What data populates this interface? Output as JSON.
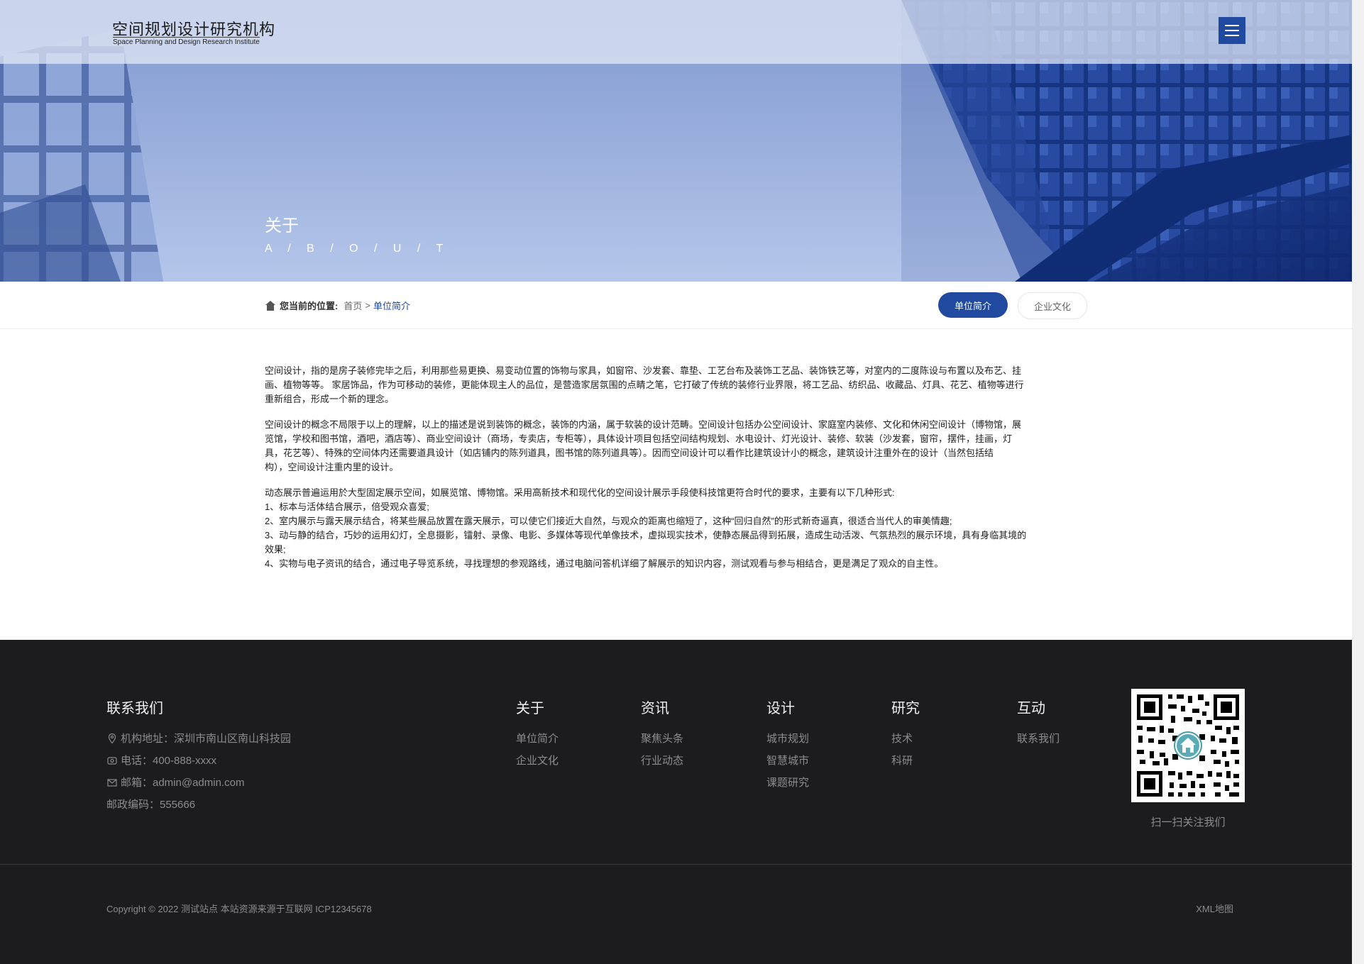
{
  "header": {
    "logo_cn": "空间规划设计研究机构",
    "logo_en": "Space Planning and Design Research Institute",
    "menu_icon": "hamburger-menu-icon"
  },
  "hero": {
    "title": "关于",
    "subtitle": "A / B / O / U / T"
  },
  "breadcrumb": {
    "label": "您当前的位置:",
    "home": "首页",
    "separator": ">",
    "current": "单位简介"
  },
  "tabs": [
    {
      "label": "单位简介",
      "active": true
    },
    {
      "label": "企业文化",
      "active": false
    }
  ],
  "content": {
    "p1": [
      "空间设计，指的是房子装修完毕之后，利用那些易更换、易变动位置的饰物与家具，如窗帘、沙发套、靠垫、工艺台布及装饰工艺品、装饰铁艺等，对室内的二度陈设与布置以及布艺、挂",
      "画、植物等等。 家居饰品，作为可移动的装修，更能体现主人的品位，是营造家居氛围的点睛之笔，它打破了传统的装修行业界限，将工艺品、纺织品、收藏品、灯具、花艺、植物等进行",
      "重新组合，形成一个新的理念。"
    ],
    "p2": [
      "空间设计的概念不局限于以上的理解，以上的描述是说到装饰的概念，装饰的内涵，属于软装的设计范畴。空间设计包括办公空间设计、家庭室内装修、文化和休闲空间设计（博物馆，展",
      "览馆，学校和图书馆，酒吧，酒店等）、商业空间设计（商场，专卖店，专柜等），具体设计项目包括空间结构规划、水电设计、灯光设计、装修、软装（沙发套，窗帘，摆件，挂画，灯",
      "具，花艺等）、特殊的空间体内还需要道具设计（如店铺内的陈列道具，图书馆的陈列道具等）。因而空间设计可以看作比建筑设计小的概念，建筑设计注重外在的设计（当然包括结",
      "构），空间设计注重内里的设计。"
    ],
    "p3": [
      "动态展示普遍运用於大型固定展示空间，如展览馆、博物馆。采用高新技术和现代化的空间设计展示手段使科技馆更符合时代的要求，主要有以下几种形式:",
      "1、标本与活体结合展示，倍受观众喜爱;",
      "2、室内展示与露天展示结合，将某些展品放置在露天展示，可以使它们接近大自然，与观众的距离也缩短了，这种“回归自然”的形式新奇逼真，很适合当代人的审美情趣;",
      "3、动与静的结合，巧妙的运用幻灯，全息摄影，镭射、录像、电影、多媒体等现代单像技术，虚拟现实技术，使静态展品得到拓展，造成生动活泼、气氛热烈的展示环境，具有身临其境的",
      "效果;",
      "4、实物与电子资讯的结合，通过电子导览系统，寻找理想的参观路线，通过电脑问答机详细了解展示的知识内容，测试观看与参与相结合，更是满足了观众的自主性。"
    ]
  },
  "footer": {
    "contact": {
      "title": "联系我们",
      "address": "机构地址：深圳市南山区南山科技园",
      "phone": "电话：400-888-xxxx",
      "email": "邮箱：admin@admin.com",
      "postcode": "邮政编码：555666"
    },
    "columns": [
      {
        "title": "关于",
        "items": [
          "单位简介",
          "企业文化"
        ]
      },
      {
        "title": "资讯",
        "items": [
          "聚焦头条",
          "行业动态"
        ]
      },
      {
        "title": "设计",
        "items": [
          "城市规划",
          "智慧城市",
          "课题研究"
        ]
      },
      {
        "title": "研究",
        "items": [
          "技术",
          "科研"
        ]
      },
      {
        "title": "互动",
        "items": [
          "联系我们"
        ]
      }
    ],
    "qr_caption": "扫一扫关注我们",
    "copyright": "Copyright © 2022 测试站点 本站资源来源于互联网   ICP12345678",
    "sitemap": "XML地图"
  },
  "colors": {
    "accent": "#1f4aa0",
    "footer_bg": "#1c1c1e",
    "footer_text": "#8c8c8c"
  }
}
